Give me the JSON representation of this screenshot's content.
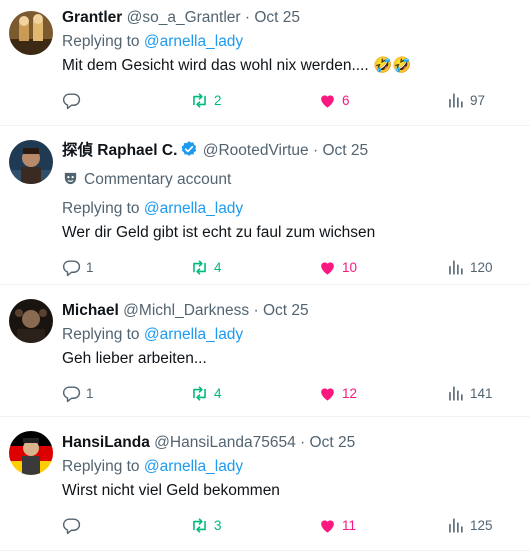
{
  "tweets": [
    {
      "name": "Grantler",
      "handle": "@so_a_Grantler",
      "date": "Oct 25",
      "replying_prefix": "Replying to ",
      "replying_to": "@arnella_lady",
      "text": "Mit dem Gesicht wird das wohl nix werden.... 🤣🤣",
      "replies": "",
      "retweets": "2",
      "likes": "6",
      "views": "97"
    },
    {
      "name": "探偵 Raphael C.",
      "handle": "@RootedVirtue",
      "date": "Oct 25",
      "label": "Commentary account",
      "replying_prefix": "Replying to ",
      "replying_to": "@arnella_lady",
      "text": "Wer dir Geld gibt ist echt zu faul zum wichsen",
      "replies": "1",
      "retweets": "4",
      "likes": "10",
      "views": "120"
    },
    {
      "name": "Michael",
      "handle": "@Michl_Darkness",
      "date": "Oct 25",
      "replying_prefix": "Replying to ",
      "replying_to": "@arnella_lady",
      "text": "Geh lieber arbeiten...",
      "replies": "1",
      "retweets": "4",
      "likes": "12",
      "views": "141"
    },
    {
      "name": "HansiLanda",
      "handle": "@HansiLanda75654",
      "date": "Oct 25",
      "replying_prefix": "Replying to ",
      "replying_to": "@arnella_lady",
      "text": "Wirst nicht viel Geld bekommen",
      "replies": "",
      "retweets": "3",
      "likes": "11",
      "views": "125"
    }
  ],
  "separator": " · ",
  "colors": {
    "link": "#1d9bf0",
    "muted": "#536471",
    "retweet": "#00ba7c",
    "like": "#f91880",
    "divider": "#eff3f4"
  },
  "icons": [
    "reply-icon",
    "retweet-icon",
    "like-icon",
    "views-icon",
    "verified-badge-icon",
    "commentary-mask-icon"
  ]
}
